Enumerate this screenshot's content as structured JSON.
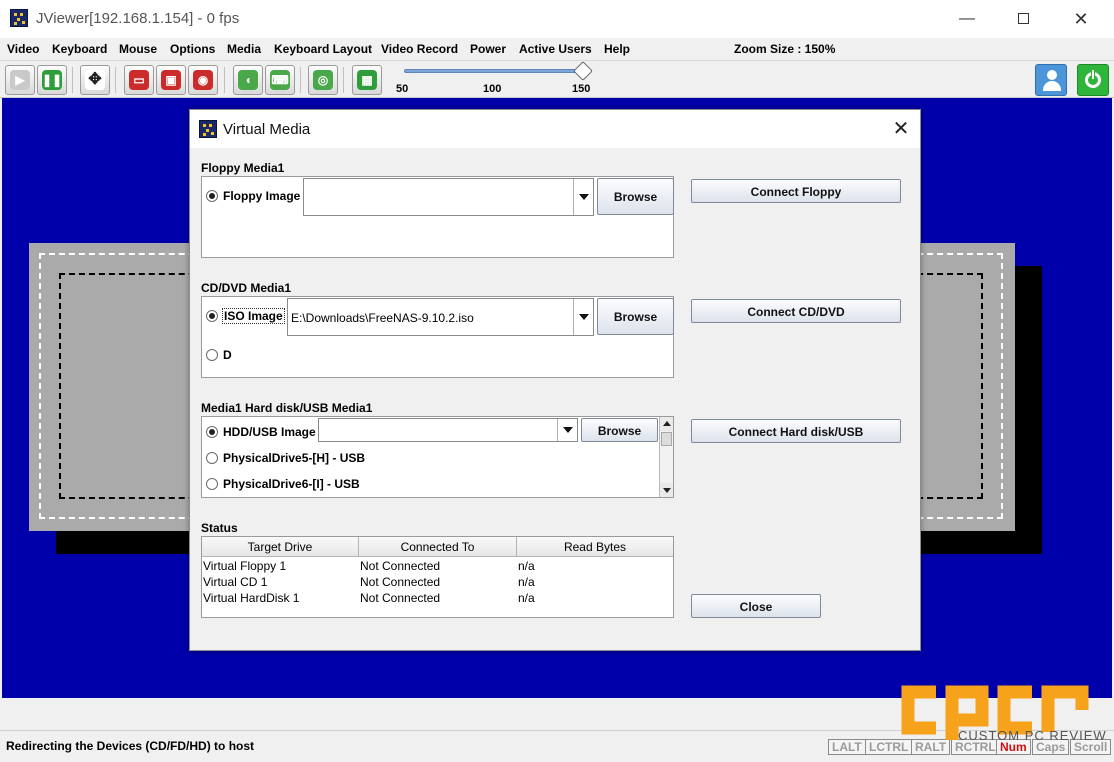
{
  "window": {
    "title": "JViewer[192.168.1.154] - 0 fps",
    "controls": {
      "minimize": "—",
      "close": "✕"
    }
  },
  "menu": {
    "items": [
      {
        "label": "Video"
      },
      {
        "label": "Keyboard"
      },
      {
        "label": "Mouse"
      },
      {
        "label": "Options"
      },
      {
        "label": "Media"
      },
      {
        "label": "Keyboard Layout"
      },
      {
        "label": "Video Record"
      },
      {
        "label": "Power"
      },
      {
        "label": "Active Users"
      },
      {
        "label": "Help"
      }
    ],
    "zoom_label": "Zoom Size : 150%"
  },
  "toolbar": {
    "buttons": [
      {
        "name": "play-icon",
        "glyph": "▶"
      },
      {
        "name": "pause-icon",
        "glyph": "❚❚"
      },
      {
        "name": "fullscreen-icon",
        "glyph": "✥"
      },
      {
        "name": "floppy-redirect-icon",
        "glyph": "▭"
      },
      {
        "name": "harddisk-redirect-icon",
        "glyph": "▣"
      },
      {
        "name": "cd-redirect-icon",
        "glyph": "◉"
      },
      {
        "name": "mouse-icon",
        "glyph": "◖"
      },
      {
        "name": "keyboard-icon",
        "glyph": "⌨"
      },
      {
        "name": "video-record-icon",
        "glyph": "◎"
      },
      {
        "name": "hotkeys-icon",
        "glyph": "▦"
      }
    ],
    "zoom": {
      "min_label": "50",
      "mid_label": "100",
      "max_label": "150",
      "value": 150
    }
  },
  "dialog": {
    "title": "Virtual Media",
    "close_glyph": "✕",
    "floppy": {
      "section_label": "Floppy Media1",
      "option_label": "Floppy Image",
      "path_value": "",
      "browse_label": "Browse",
      "connect_label": "Connect Floppy"
    },
    "cd": {
      "section_label": "CD/DVD Media1",
      "option_iso_label": "ISO Image",
      "path_value": "E:\\Downloads\\FreeNAS-9.10.2.iso",
      "option_drive_label": "D",
      "browse_label": "Browse",
      "connect_label": "Connect CD/DVD"
    },
    "hdd": {
      "section_label": "Media1 Hard disk/USB Media1",
      "option_image_label": "HDD/USB Image",
      "path_value": "",
      "browse_label": "Browse",
      "option_drive5_label": "PhysicalDrive5-[H] - USB",
      "option_drive6_label": "PhysicalDrive6-[I] - USB",
      "connect_label": "Connect Hard disk/USB"
    },
    "status": {
      "section_label": "Status",
      "columns": [
        "Target Drive",
        "Connected To",
        "Read Bytes"
      ],
      "rows": [
        [
          "Virtual Floppy 1",
          "Not Connected",
          "n/a"
        ],
        [
          "Virtual CD 1",
          "Not Connected",
          "n/a"
        ],
        [
          "Virtual HardDisk 1",
          "Not Connected",
          "n/a"
        ]
      ]
    },
    "close_label": "Close"
  },
  "statusbar": {
    "text": "Redirecting the Devices (CD/FD/HD) to host",
    "keys": [
      {
        "label": "LALT",
        "active": false
      },
      {
        "label": "LCTRL",
        "active": false
      },
      {
        "label": "RALT",
        "active": false
      },
      {
        "label": "RCTRL",
        "active": false
      },
      {
        "label": "Num",
        "active": true
      },
      {
        "label": "Caps",
        "active": false
      },
      {
        "label": "Scroll",
        "active": false
      }
    ]
  },
  "watermark": {
    "logo_text": "cpcr",
    "caption": "CUSTOM PC REVIEW"
  },
  "colors": {
    "remote_background": "#0000aa",
    "remote_panel": "#aaaaaa",
    "accent_green": "#2fb53a",
    "accent_blue": "#4b95d8",
    "watermark_orange": "#f7a21b",
    "num_lock_active": "#d01010"
  }
}
